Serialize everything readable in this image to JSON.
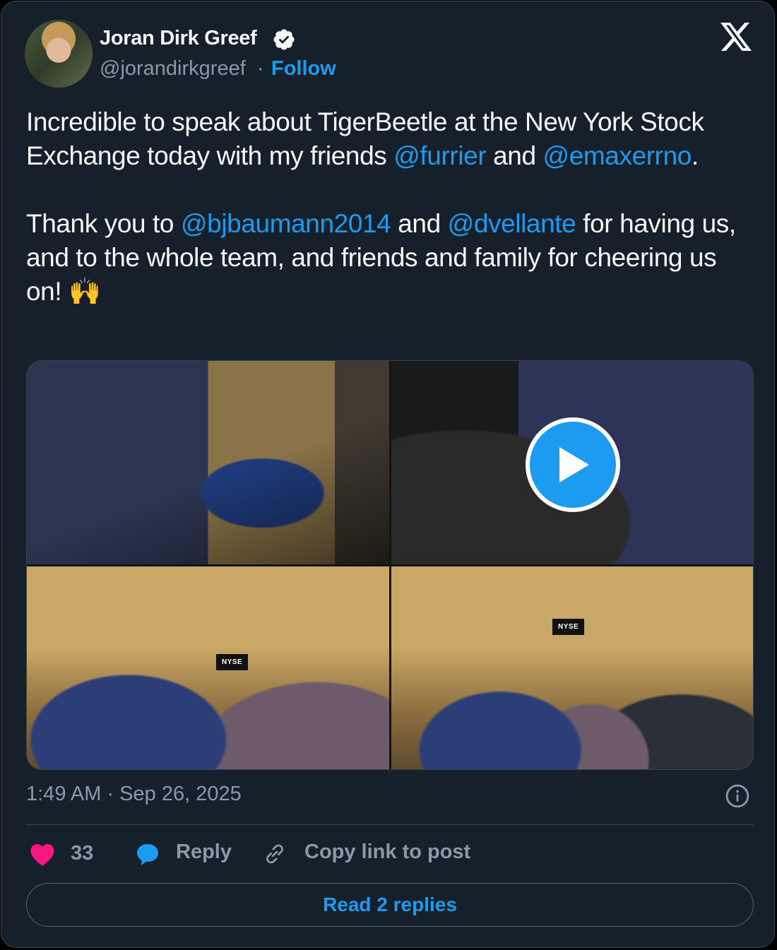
{
  "author": {
    "name": "Joran Dirk Greef",
    "handle": "@jorandirkgreef",
    "separator": "·",
    "follow_label": "Follow",
    "verified": true
  },
  "tweet": {
    "p1_a": "Incredible to speak about TigerBeetle at the New York Stock Exchange today with my friends ",
    "mention_1": "@furrier",
    "p1_b": " and ",
    "mention_2": "@emaxerrno",
    "p1_c": ".",
    "p2_a": "Thank you to ",
    "mention_3": "@bjbaumann2014",
    "p2_b": " and ",
    "mention_4": "@dvellante",
    "p2_c": " for having us, and to the whole team, and friends and family for cheering us on! 🙌"
  },
  "media": {
    "photos": [
      "photo-interview-set",
      "video-control-room",
      "photo-nyse-floor-duo",
      "photo-nyse-floor-trio"
    ],
    "sign_text": "NYSE",
    "has_video": true
  },
  "timestamp": "1:49 AM · Sep 26, 2025",
  "actions": {
    "like_count": "33",
    "reply_label": "Reply",
    "copy_label": "Copy link to post"
  },
  "read_replies_label": "Read 2 replies",
  "colors": {
    "background": "#15202b",
    "accent": "#1d9bf0",
    "heart": "#f91880",
    "muted": "#8b98a5"
  }
}
